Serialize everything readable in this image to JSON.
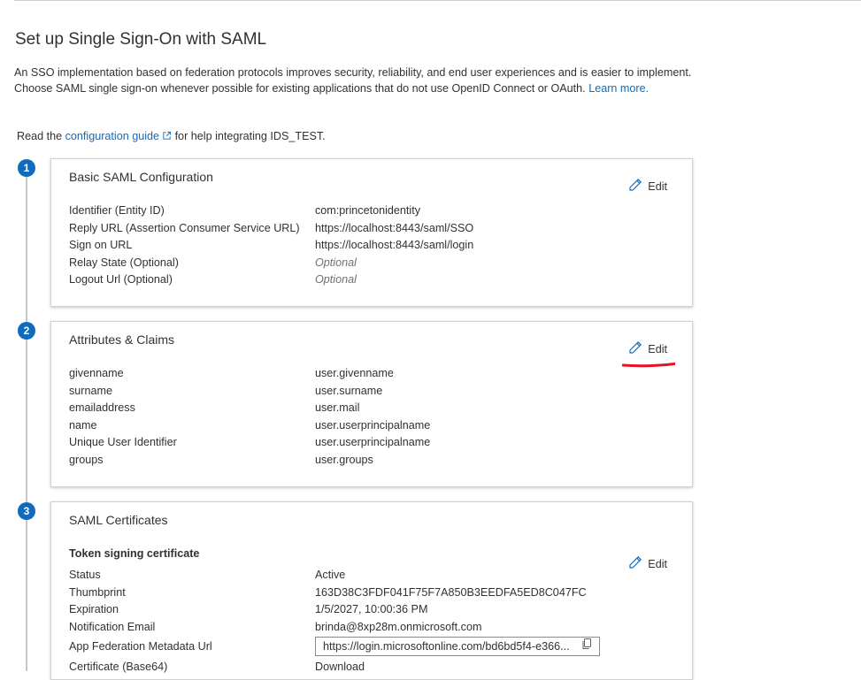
{
  "page": {
    "title": "Set up Single Sign-On with SAML",
    "intro_text": "An SSO implementation based on federation protocols improves security, reliability, and end user experiences and is easier to implement. Choose SAML single sign-on whenever possible for existing applications that do not use OpenID Connect or OAuth.",
    "learn_more": "Learn more.",
    "read_prefix": "Read the",
    "config_guide_link": "configuration guide",
    "read_suffix": "for help integrating IDS_TEST."
  },
  "steps": [
    {
      "number": "1",
      "title": "Basic SAML Configuration",
      "edit_label": "Edit",
      "rows": [
        {
          "key": "Identifier (Entity ID)",
          "value": "com:princetonidentity"
        },
        {
          "key": "Reply URL (Assertion Consumer Service URL)",
          "value": "https://localhost:8443/saml/SSO"
        },
        {
          "key": "Sign on URL",
          "value": "https://localhost:8443/saml/login"
        },
        {
          "key": "Relay State (Optional)",
          "value": "Optional"
        },
        {
          "key": "Logout Url (Optional)",
          "value": "Optional"
        }
      ]
    },
    {
      "number": "2",
      "title": "Attributes & Claims",
      "edit_label": "Edit",
      "rows": [
        {
          "key": "givenname",
          "value": "user.givenname"
        },
        {
          "key": "surname",
          "value": "user.surname"
        },
        {
          "key": "emailaddress",
          "value": "user.mail"
        },
        {
          "key": "name",
          "value": "user.userprincipalname"
        },
        {
          "key": "Unique User Identifier",
          "value": "user.userprincipalname"
        },
        {
          "key": "groups",
          "value": "user.groups"
        }
      ]
    },
    {
      "number": "3",
      "title": "SAML Certificates",
      "edit_label": "Edit",
      "subheading": "Token signing certificate",
      "rows": [
        {
          "key": "Status",
          "value": "Active"
        },
        {
          "key": "Thumbprint",
          "value": "163D38C3FDF041F75F7A850B3EEDFA5ED8C047FC"
        },
        {
          "key": "Expiration",
          "value": "1/5/2027, 10:00:36 PM"
        },
        {
          "key": "Notification Email",
          "value": "brinda@8xp28m.onmicrosoft.com"
        },
        {
          "key": "App Federation Metadata Url",
          "value": "https://login.microsoftonline.com/bd6bd5f4-e366..."
        },
        {
          "key": "Certificate (Base64)",
          "value": "Download"
        }
      ]
    }
  ],
  "colors": {
    "accent": "#0f6cbd",
    "annotation_red": "#e81123"
  },
  "icons": {
    "edit": "pencil-icon",
    "external": "external-link-icon",
    "copy": "copy-icon"
  }
}
